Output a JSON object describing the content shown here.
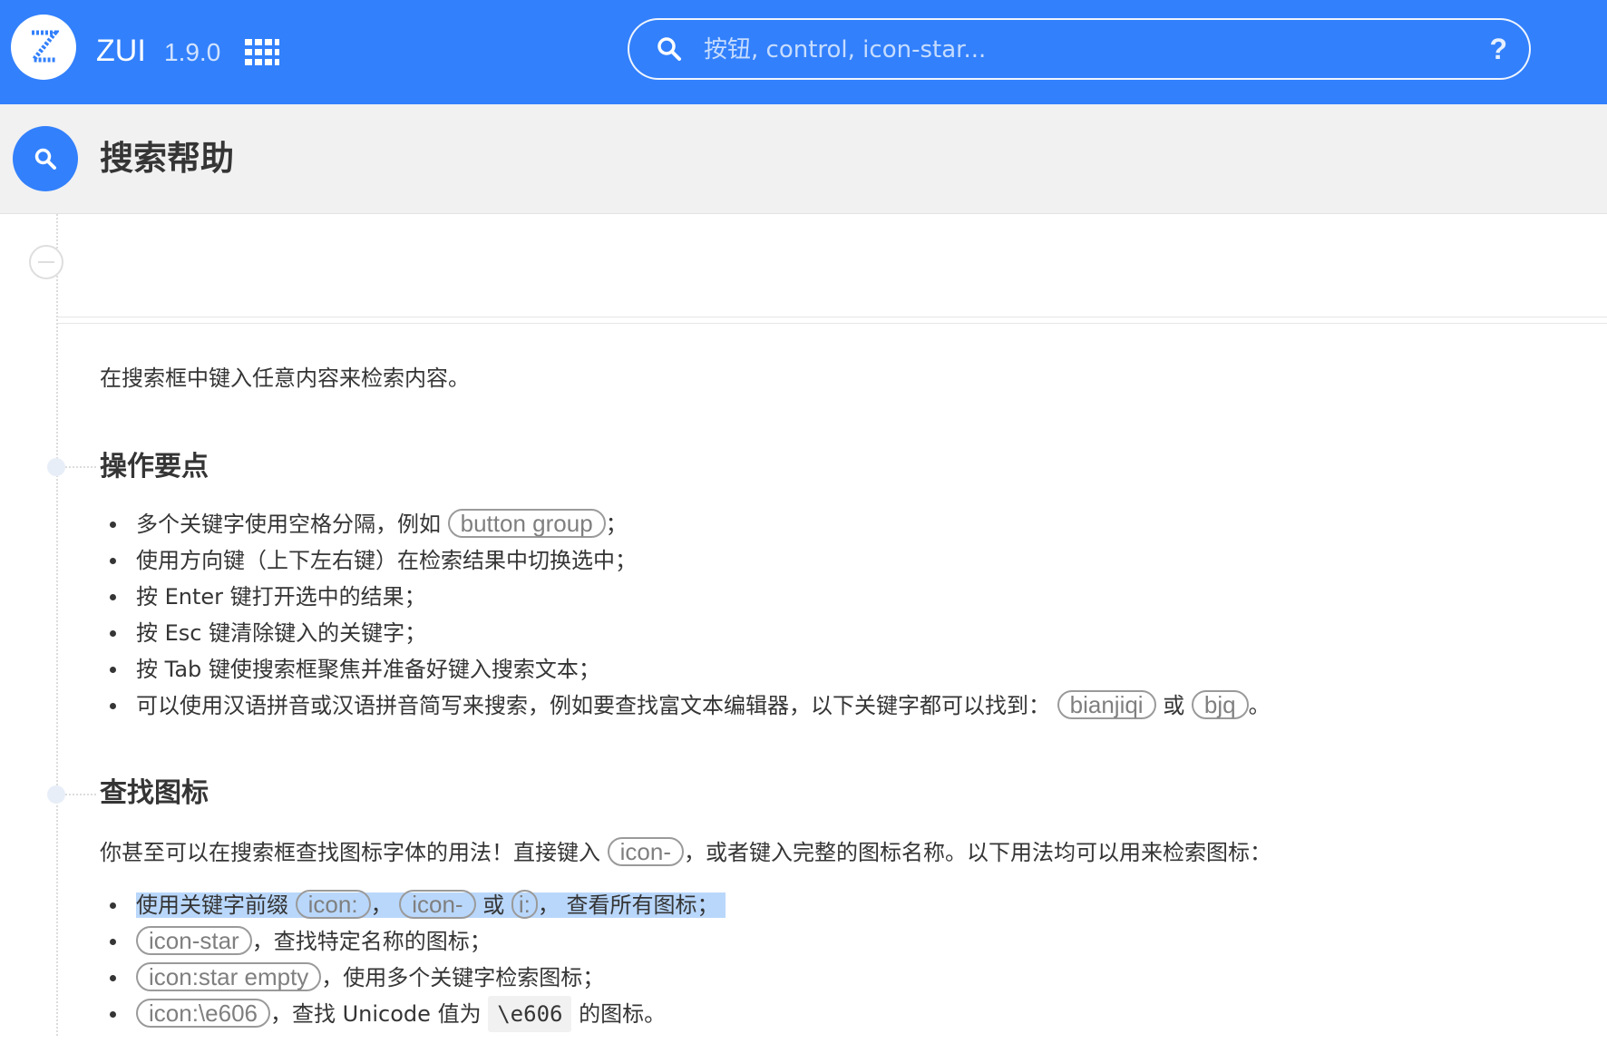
{
  "header": {
    "logo_letter": "Z",
    "brand": "ZUI",
    "version": "1.9.0",
    "apps_icon": "grid-icon",
    "search_placeholder": "按钮, control, icon-star...",
    "search_value": "",
    "help_label": "?"
  },
  "titlebar": {
    "icon": "search-icon",
    "title": "搜索帮助"
  },
  "intro": "在搜索框中键入任意内容来检索内容。",
  "section1": {
    "heading": "操作要点",
    "items": [
      {
        "text_before": "多个关键字使用空格分隔，例如",
        "kw": "button group",
        "text_after": "；"
      },
      {
        "text": "使用方向键（上下左右键）在检索结果中切换选中；"
      },
      {
        "text": "按 Enter 键打开选中的结果；"
      },
      {
        "text": "按 Esc 键清除键入的关键字；"
      },
      {
        "text": "按 Tab 键使搜索框聚焦并准备好键入搜索文本；"
      },
      {
        "text_before": "可以使用汉语拼音或汉语拼音简写来搜索，例如要查找富文本编辑器，以下关键字都可以找到：",
        "kw1": "bianjiqi",
        "mid": "或",
        "kw2": "bjq",
        "text_after": "。"
      }
    ]
  },
  "section2": {
    "heading": "查找图标",
    "para_before": "你甚至可以在搜索框查找图标字体的用法！直接键入",
    "para_kw": "icon-",
    "para_after": "，或者键入完整的图标名称。以下用法均可以用来检索图标：",
    "items": [
      {
        "text_before": "使用关键字前缀",
        "kw1": "icon:",
        "sep1": "，",
        "kw2": "icon-",
        "mid": "或",
        "kw3": "i:",
        "text_after": "，  查看所有图标；"
      },
      {
        "kw": "icon-star",
        "text_after": "，查找特定名称的图标；"
      },
      {
        "kw": "icon:star empty",
        "text_after": "，使用多个关键字检索图标；"
      },
      {
        "kw": "icon:\\e606",
        "text_mid": "，查找 Unicode 值为",
        "code": "\\e606",
        "text_after": "的图标。"
      }
    ]
  }
}
